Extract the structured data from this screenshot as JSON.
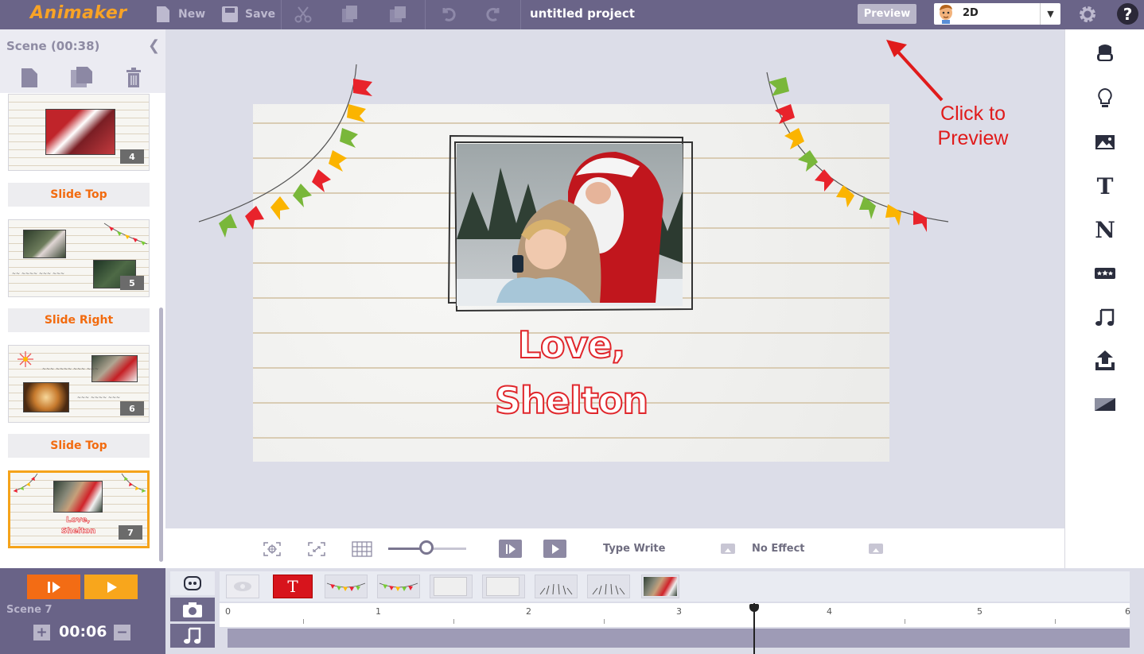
{
  "app": {
    "logo": "Animaker",
    "project_title": "untitled project"
  },
  "toolbar": {
    "new_label": "New",
    "save_label": "Save",
    "preview_label": "Preview",
    "mode_selected": "2D"
  },
  "scene_panel": {
    "title": "Scene  (00:38)",
    "slides": [
      {
        "number": "4"
      },
      {
        "transition": "Slide Top"
      },
      {
        "number": "5"
      },
      {
        "transition": "Slide Right"
      },
      {
        "number": "6"
      },
      {
        "transition": "Slide Top"
      },
      {
        "number": "7"
      }
    ]
  },
  "canvas": {
    "line1": "Love,",
    "line2": "Shelton"
  },
  "annotation": {
    "line1": "Click to",
    "line2": "Preview",
    "color": "#e01b1b"
  },
  "controls": {
    "text_effect": "Type Write",
    "exit_effect": "No Effect"
  },
  "timeline": {
    "scene_label": "Scene  7",
    "duration": "00:06",
    "ruler_labels": [
      "0",
      "1",
      "2",
      "3",
      "4",
      "5",
      "6"
    ],
    "playhead_seconds": 3.5
  },
  "colors": {
    "topbar": "#6a6488",
    "accent_orange": "#f5a31a",
    "transition_text": "#f26b0f",
    "text_red": "#e0262b"
  }
}
